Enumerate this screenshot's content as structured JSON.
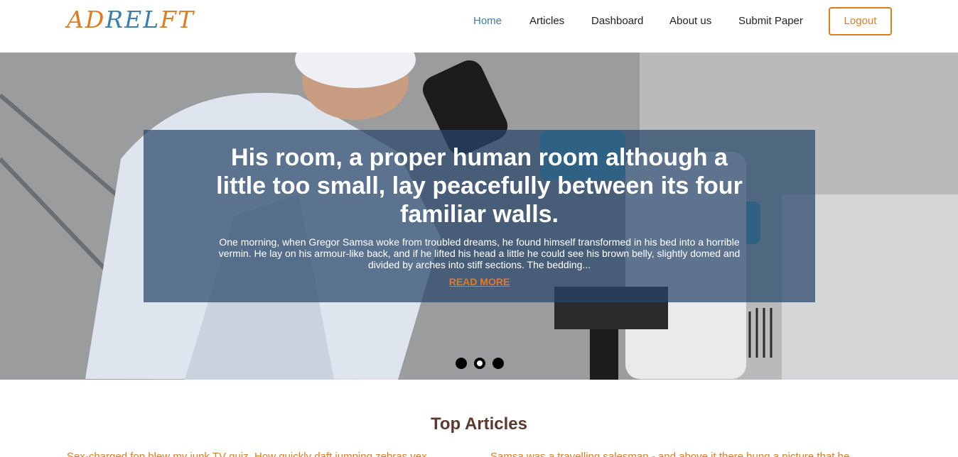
{
  "header": {
    "logo_text": "ADRELFT",
    "nav": [
      {
        "label": "Home",
        "active": true
      },
      {
        "label": "Articles",
        "active": false
      },
      {
        "label": "Dashboard",
        "active": false
      },
      {
        "label": "About us",
        "active": false
      },
      {
        "label": "Submit Paper",
        "active": false
      }
    ],
    "logout_label": "Logout"
  },
  "hero": {
    "title": "His room, a proper human room although a little too small, lay peacefully between its four familiar walls.",
    "body": "One morning, when Gregor Samsa woke from troubled dreams, he found himself transformed in his bed into a horrible vermin. He lay on his armour-like back, and if he lifted his head a little he could see his brown belly, slightly domed and divided by arches into stiff sections. The bedding...",
    "read_more": "READ MORE",
    "slides": 3,
    "active_slide": 2
  },
  "top_articles": {
    "title": "Top Articles",
    "articles": [
      {
        "snippet": "Sex-charged fop blew my junk TV quiz. How quickly daft jumping zebras vex."
      },
      {
        "snippet": "Samsa was a travelling salesman - and above it there hung a picture that he"
      }
    ]
  },
  "colors": {
    "accent": "#e07b1e",
    "nav_active": "#3a7fb0",
    "caption_bg": "#284669",
    "heading": "#5a3a2e"
  }
}
